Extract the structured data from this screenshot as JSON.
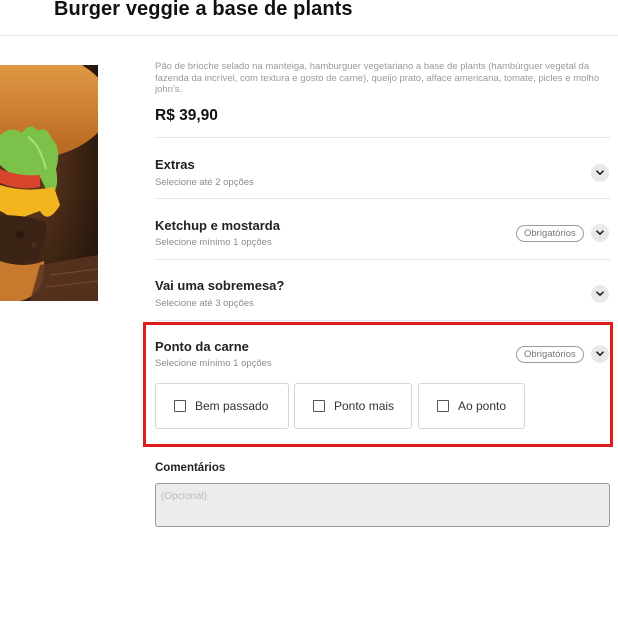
{
  "product": {
    "title": "Burger veggie a base de plants",
    "description": "Pão de brioche selado na manteiga, hamburguer vegetariano a base de plants (hambúrguer vegetal da fazenda da incrível, com textura e gosto de carne), queijo prato, alface americana, tomate, picles e molho john's.",
    "price": "R$ 39,90"
  },
  "sections": [
    {
      "title": "Extras",
      "subtitle": "Selecione até 2 opções",
      "badge": ""
    },
    {
      "title": "Ketchup e mostarda",
      "subtitle": "Selecione mínimo 1 opções",
      "badge": "Obrigatórios"
    },
    {
      "title": "Vai uma sobremesa?",
      "subtitle": "Selecione até 3 opções",
      "badge": ""
    },
    {
      "title": "Ponto da carne",
      "subtitle": "Selecione mínimo 1 opções",
      "badge": "Obrigatórios",
      "options": [
        {
          "label": "Bem passado",
          "checked": false
        },
        {
          "label": "Ponto mais",
          "checked": false
        },
        {
          "label": "Ao ponto",
          "checked": false
        }
      ]
    }
  ],
  "comments": {
    "label": "Comentários",
    "placeholder": "(Opcional)",
    "value": ""
  },
  "icons": {
    "section_toggle": "chevron-down-icon",
    "option_box": "checkbox-icon"
  },
  "colors": {
    "highlight": "#dd1d1d",
    "badge_border": "#9c9c9c",
    "chevron_bg": "#e9e9e9"
  }
}
